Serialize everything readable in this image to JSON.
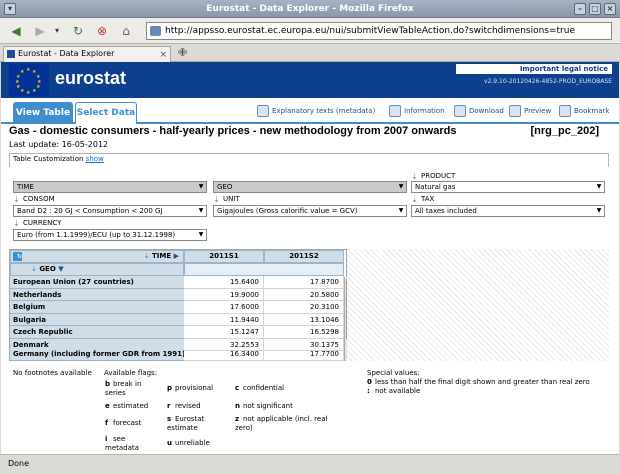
{
  "window": {
    "title": "Eurostat - Data Explorer - Mozilla Firefox"
  },
  "browser": {
    "url": "http://appsso.eurostat.ec.europa.eu/nui/submitViewTableAction.do?switchdimensions=true",
    "tab_label": "Eurostat - Data Explorer",
    "new_tab": "✙",
    "status": "Done"
  },
  "banner": {
    "brand": "eurostat",
    "legal": "Important legal notice",
    "version": "v2.9.10-20120426-4852-PROD_EUROBASE"
  },
  "tabs": {
    "view_table": "View Table",
    "select_data": "Select Data"
  },
  "tools": {
    "explanatory": "Explanatory texts (metadata)",
    "information": "Information",
    "download": "Download",
    "preview": "Preview",
    "bookmark": "Bookmark"
  },
  "page": {
    "title": "Gas - domestic consumers - half-yearly prices - new methodology from 2007 onwards",
    "code": "[nrg_pc_202]",
    "last_update": "Last update: 16-05-2012",
    "customization": "Table Customization",
    "show_link": "show"
  },
  "dims": {
    "time": "TIME",
    "geo": "GEO",
    "product_label": "PRODUCT",
    "product_value": "Natural gas",
    "consom_label": "CONSOM",
    "consom_value": "Band D2 : 20 GJ < Consumption < 200 GJ",
    "unit_label": "UNIT",
    "unit_value": "Gigajoules (Gross calorific value = GCV)",
    "tax_label": "TAX",
    "tax_value": "All taxes included",
    "currency_label": "CURRENCY",
    "currency_value": "Euro (from 1.1.1999)/ECU (up to 31.12.1998)"
  },
  "table": {
    "time_header": "TIME",
    "geo_header": "GEO",
    "columns": [
      "2011S1",
      "2011S2"
    ],
    "rows": [
      {
        "geo": "European Union (27 countries)",
        "v1": "15.6400",
        "v2": "17.8700"
      },
      {
        "geo": "Netherlands",
        "v1": "19.9000",
        "v2": "20.5800"
      },
      {
        "geo": "Belgium",
        "v1": "17.6000",
        "v2": "20.3100"
      },
      {
        "geo": "Bulgaria",
        "v1": "11.9440",
        "v2": "13.1046"
      },
      {
        "geo": "Czech Republic",
        "v1": "15.1247",
        "v2": "16.5298"
      },
      {
        "geo": "Denmark",
        "v1": "32.2553",
        "v2": "30.1375"
      },
      {
        "geo": "Germany (including former GDR from 1991)",
        "v1": "16.3400",
        "v2": "17.7700"
      }
    ]
  },
  "notes": {
    "footnotes": "No footnotes available",
    "flags_title": "Available flags:",
    "flags": [
      {
        "code": "b",
        "text": "break in series"
      },
      {
        "code": "p",
        "text": "provisional"
      },
      {
        "code": "c",
        "text": "confidential"
      },
      {
        "code": "e",
        "text": "estimated"
      },
      {
        "code": "r",
        "text": "revised"
      },
      {
        "code": "n",
        "text": "not significant"
      },
      {
        "code": "f",
        "text": "forecast"
      },
      {
        "code": "s",
        "text": "Eurostat estimate"
      },
      {
        "code": "z",
        "text": "not applicable (incl. real zero)"
      },
      {
        "code": "i",
        "text": "see metadata"
      },
      {
        "code": "u",
        "text": "unreliable"
      }
    ],
    "special_title": "Special values:",
    "special": [
      {
        "code": "0",
        "text": "less than half the final digit shown and greater than real zero"
      },
      {
        "code": ":",
        "text": "not available"
      }
    ]
  }
}
